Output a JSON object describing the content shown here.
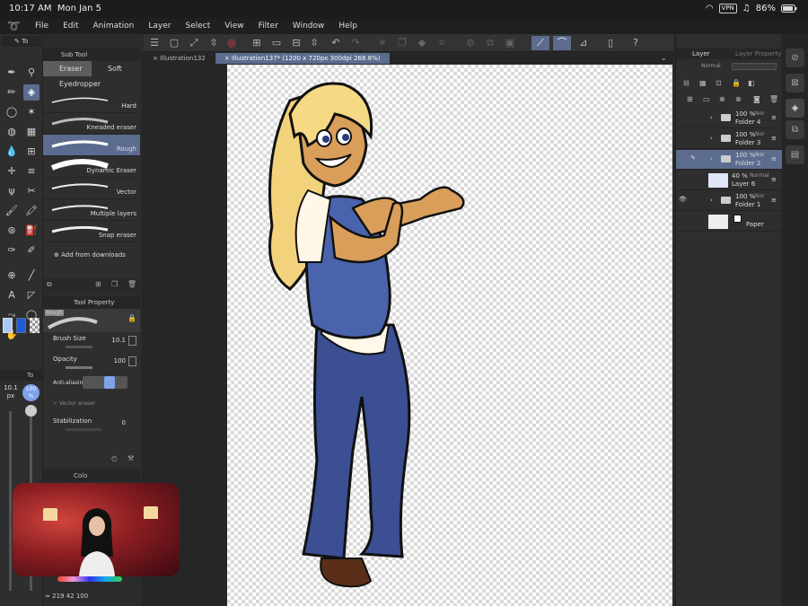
{
  "status": {
    "time": "10:17 AM",
    "date": "Mon Jan 5",
    "vpn": "VPN",
    "battery": "86%"
  },
  "menu": [
    "File",
    "Edit",
    "Animation",
    "Layer",
    "Select",
    "View",
    "Filter",
    "Window",
    "Help"
  ],
  "doc_tabs": [
    "Illustration132",
    "Illustration137* (1200 x 720px 300dpi 268.8%)"
  ],
  "subtool": {
    "tool_label": "To",
    "panel_title": "Sub Tool",
    "tabs": [
      "Eraser",
      "Soft",
      "Eyedropper"
    ],
    "brushes": [
      "Hard",
      "Kneaded eraser",
      "Rough",
      "Dynamic Eraser",
      "Vector",
      "Multiple layers",
      "Snap eraser"
    ],
    "add": "Add from downloads"
  },
  "toolprop": {
    "title": "Tool Property",
    "preset": "Rough",
    "brush_size_label": "Brush Size",
    "brush_size": "10.1",
    "opacity_label": "Opacity",
    "opacity": "100",
    "aa_label": "Anti-aliasing",
    "vector_label": "Vector eraser",
    "stab_label": "Stabilization",
    "stab": "0"
  },
  "size_slider": {
    "value": "10.1",
    "unit": "px",
    "opacity": "100",
    "opacity_unit": "%",
    "tab": "To"
  },
  "color_panel": {
    "label": "Colo",
    "readout": "219  42  100"
  },
  "layers_panel": {
    "tab": "Layer",
    "tab2": "Layer Property",
    "blend": "Normal",
    "rows": [
      {
        "pct": "100 %",
        "mode": "Nor",
        "name": "Folder 4",
        "type": "folder"
      },
      {
        "pct": "100 %",
        "mode": "Nor",
        "name": "Folder 3",
        "type": "folder"
      },
      {
        "pct": "100 %",
        "mode": "Nor",
        "name": "Folder 2",
        "type": "folder"
      },
      {
        "pct": "40 %",
        "mode": "Normal",
        "name": "Layer 6",
        "type": "raster"
      },
      {
        "pct": "100 %",
        "mode": "Nor",
        "name": "Folder 1",
        "type": "folder"
      },
      {
        "pct": "",
        "mode": "",
        "name": "Paper",
        "type": "paper"
      }
    ]
  },
  "colors": {
    "accent": "#5b6c8f",
    "main_color": "#1e5bd6",
    "sub_color": "#a9c8f5"
  }
}
